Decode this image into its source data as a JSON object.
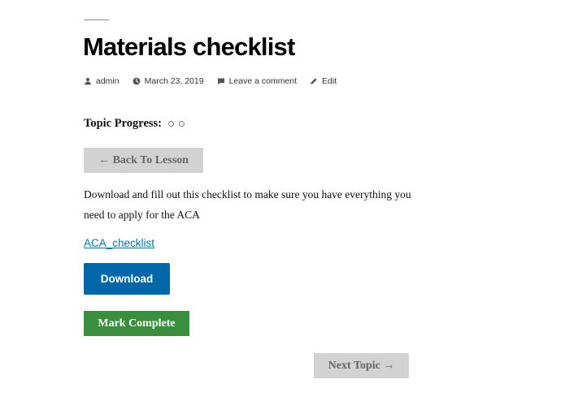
{
  "post": {
    "title": "Materials checklist",
    "meta": {
      "author": "admin",
      "date": "March 23, 2019",
      "comments_label": "Leave a comment",
      "edit_label": "Edit",
      "icons": [
        "user-icon",
        "clock-icon",
        "comment-icon",
        "pencil-icon"
      ]
    }
  },
  "progress": {
    "label": "Topic Progress:",
    "steps_total": 2,
    "steps_completed": 0
  },
  "navigation": {
    "back_label": "← Back To Lesson",
    "next_label": "Next Topic →"
  },
  "content": {
    "description": "Download and fill out this checklist to make sure you have everything you need to apply for the ACA",
    "file_link": "ACA_checklist",
    "download_label": "Download",
    "mark_complete_label": "Mark Complete"
  },
  "colors": {
    "link": "#0073aa",
    "download_button": "#0068a8",
    "complete_button": "#3a8f3e",
    "nav_button": "#d2d2d2",
    "nav_button_text": "#666666"
  }
}
